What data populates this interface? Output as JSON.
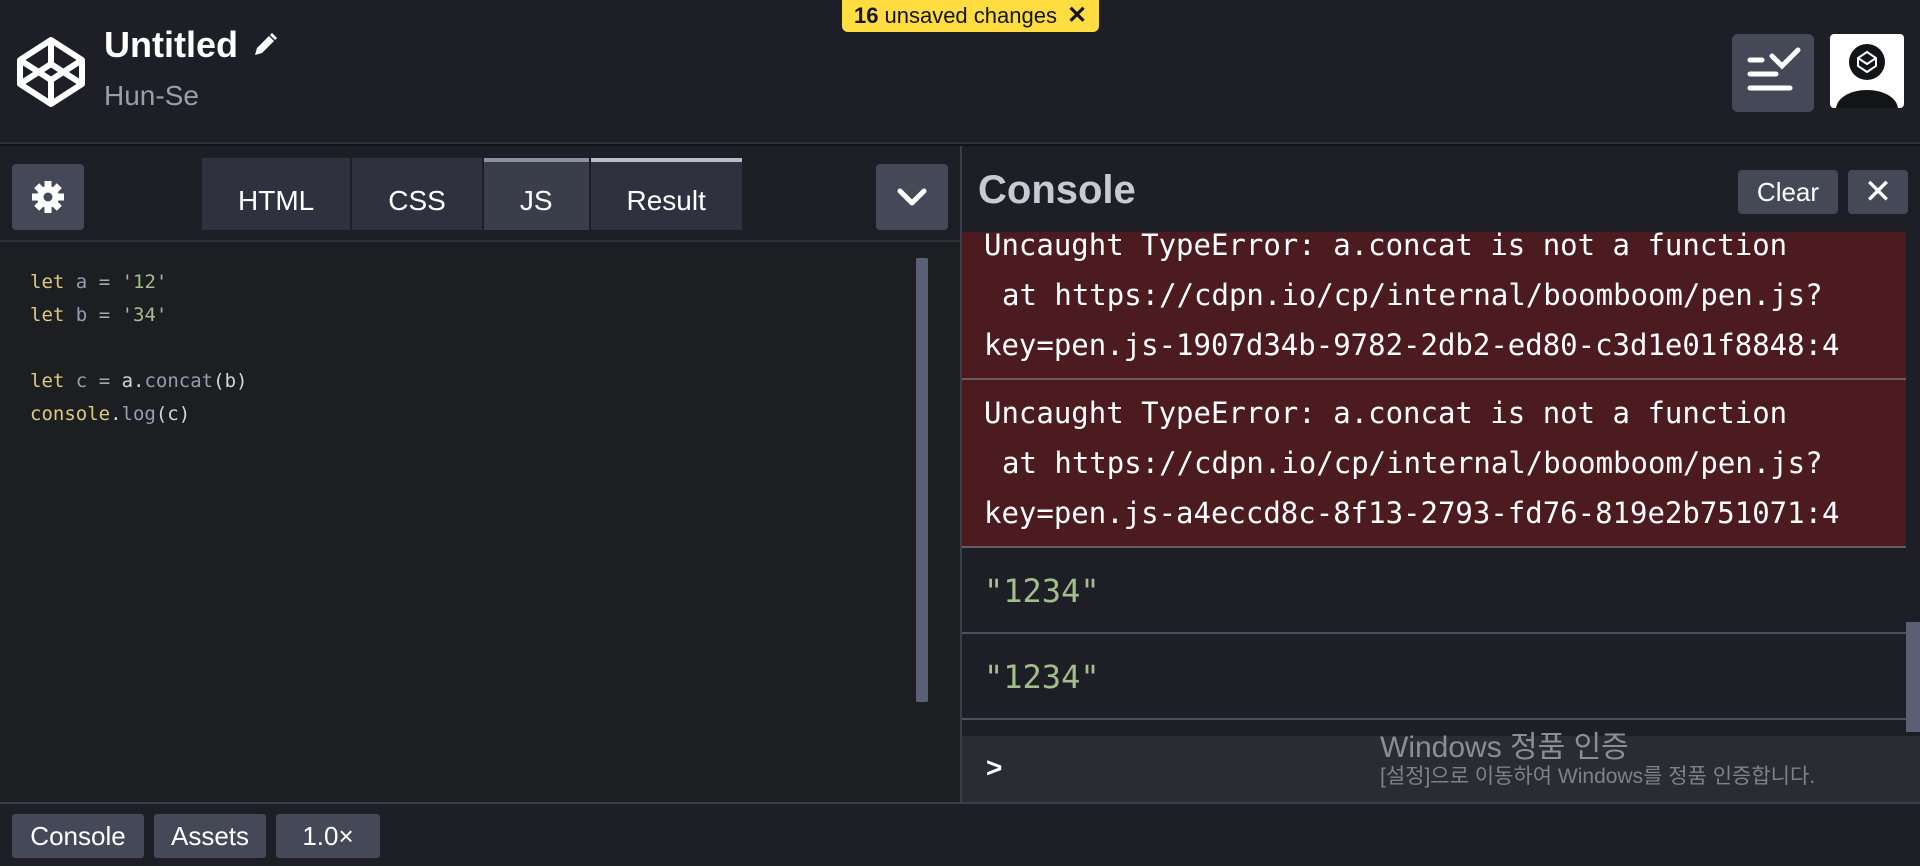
{
  "header": {
    "title": "Untitled",
    "author": "Hun-Se",
    "unsaved_count": "16",
    "unsaved_text": "unsaved changes",
    "unsaved_close": "✕"
  },
  "editor": {
    "tabs": [
      {
        "label": "HTML"
      },
      {
        "label": "CSS"
      },
      {
        "label": "JS"
      },
      {
        "label": "Result"
      }
    ],
    "active_tab": "JS"
  },
  "console": {
    "title": "Console",
    "clear_label": "Clear",
    "close_label": "✕",
    "entries": [
      {
        "line1": "Uncaught TypeError: a.concat is not a function",
        "line2": "at https://cdpn.io/cp/internal/boomboom/pen.js?",
        "line3": "key=pen.js-1907d34b-9782-2db2-ed80-c3d1e01f8848:4"
      },
      {
        "line1": "Uncaught TypeError: a.concat is not a function",
        "line2": "at https://cdpn.io/cp/internal/boomboom/pen.js?",
        "line3": "key=pen.js-a4eccd8c-8f13-2793-fd76-819e2b751071:4"
      }
    ],
    "outputs": [
      "\"1234\"",
      "\"1234\""
    ],
    "prompt": ">"
  },
  "watermark": {
    "line1": "Windows 정품 인증",
    "line2": "[설정]으로 이동하여 Windows를 정품 인증합니다."
  },
  "footer": {
    "console_label": "Console",
    "assets_label": "Assets",
    "zoom_label": "1.0×"
  },
  "colors": {
    "accent_yellow": "#ffdd40",
    "error_bg": "#4b1b20",
    "string_green": "#a3be8c",
    "keyword_yellow": "#ddca7e"
  }
}
